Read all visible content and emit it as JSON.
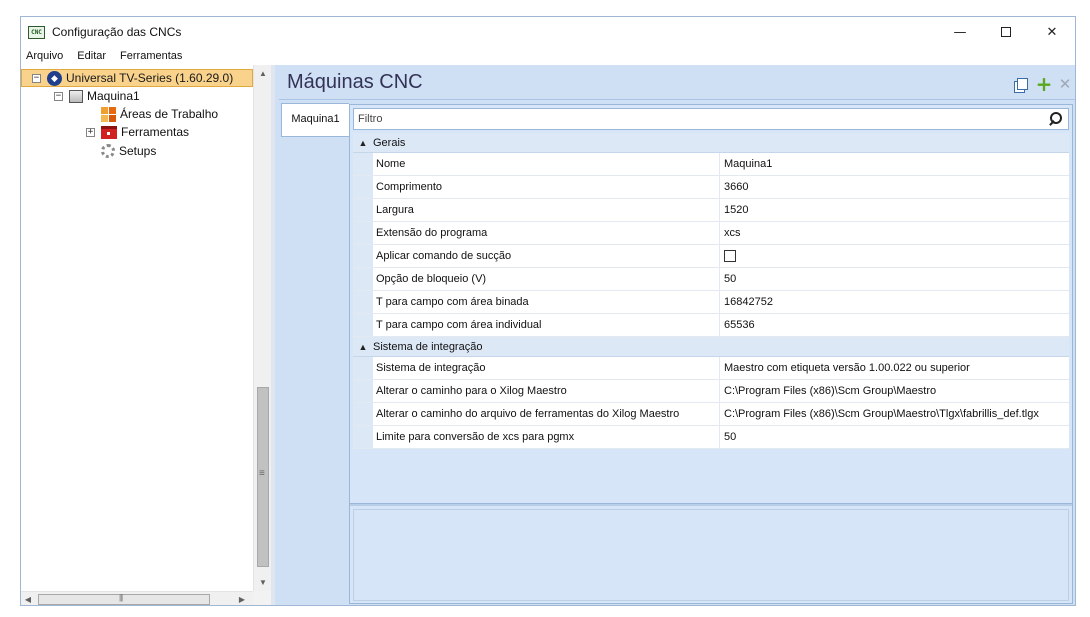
{
  "window": {
    "title": "Configuração das CNCs",
    "app_icon_text": "CNC",
    "minimize": "—",
    "close": "✕"
  },
  "menu": {
    "items": [
      "Arquivo",
      "Editar",
      "Ferramentas"
    ]
  },
  "tree": {
    "root": "Universal TV-Series (1.60.29.0)",
    "machine": "Maquina1",
    "areas": "Áreas de Trabalho",
    "tools": "Ferramentas",
    "setups": "Setups"
  },
  "panel": {
    "title": "Máquinas CNC",
    "tab": "Maquina1",
    "filter_placeholder": "Filtro"
  },
  "property_grid": {
    "gerais": {
      "label": "Gerais",
      "rows": [
        {
          "name": "Nome",
          "value": "Maquina1"
        },
        {
          "name": "Comprimento",
          "value": "3660"
        },
        {
          "name": "Largura",
          "value": "1520"
        },
        {
          "name": "Extensão do programa",
          "value": "xcs"
        },
        {
          "name": "Aplicar comando de sucção",
          "value": ""
        },
        {
          "name": "Opção de bloqueio (V)",
          "value": "50"
        },
        {
          "name": "T para campo com área binada",
          "value": "16842752"
        },
        {
          "name": "T para campo com área individual",
          "value": "65536"
        }
      ]
    },
    "integracao": {
      "label": "Sistema de integração",
      "rows": [
        {
          "name": "Sistema de integração",
          "value": "Maestro com etiqueta versão 1.00.022 ou superior"
        },
        {
          "name": "Alterar o caminho para o Xilog Maestro",
          "value": "C:\\Program Files (x86)\\Scm Group\\Maestro"
        },
        {
          "name": "Alterar o caminho do arquivo de ferramentas do Xilog Maestro",
          "value": "C:\\Program Files (x86)\\Scm Group\\Maestro\\Tlgx\\fabrillis_def.tlgx"
        },
        {
          "name": "Limite para conversão de xcs para pgmx",
          "value": "50"
        }
      ]
    }
  },
  "colors": {
    "selection": "#f9d28c",
    "panel_bg": "#cfe0f5",
    "add_icon": "#5aa820"
  },
  "icons": [
    "cnc-app-icon",
    "series-icon",
    "machine-icon",
    "areas-icon",
    "tools-icon",
    "gear-icon",
    "copy-icon",
    "plus-icon",
    "close-icon",
    "search-icon"
  ]
}
